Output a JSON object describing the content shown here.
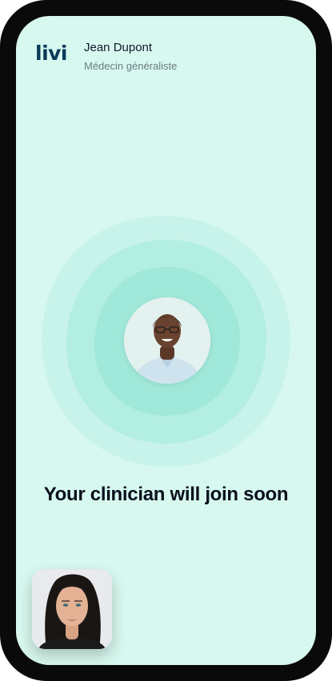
{
  "app": {
    "logo_text": "livi",
    "brand_color": "#0b3a59",
    "background_color": "#d7f8ef"
  },
  "header": {
    "doctor_name": "Jean Dupont",
    "doctor_role": "Médecin généraliste"
  },
  "waiting": {
    "status_text": "Your clinician will join soon",
    "wave_colors": [
      "#c2f1e6",
      "#b0ede1",
      "#9fe8d9"
    ]
  },
  "icons": {
    "clinician_avatar": "clinician-photo",
    "self_view": "self-camera-preview"
  }
}
